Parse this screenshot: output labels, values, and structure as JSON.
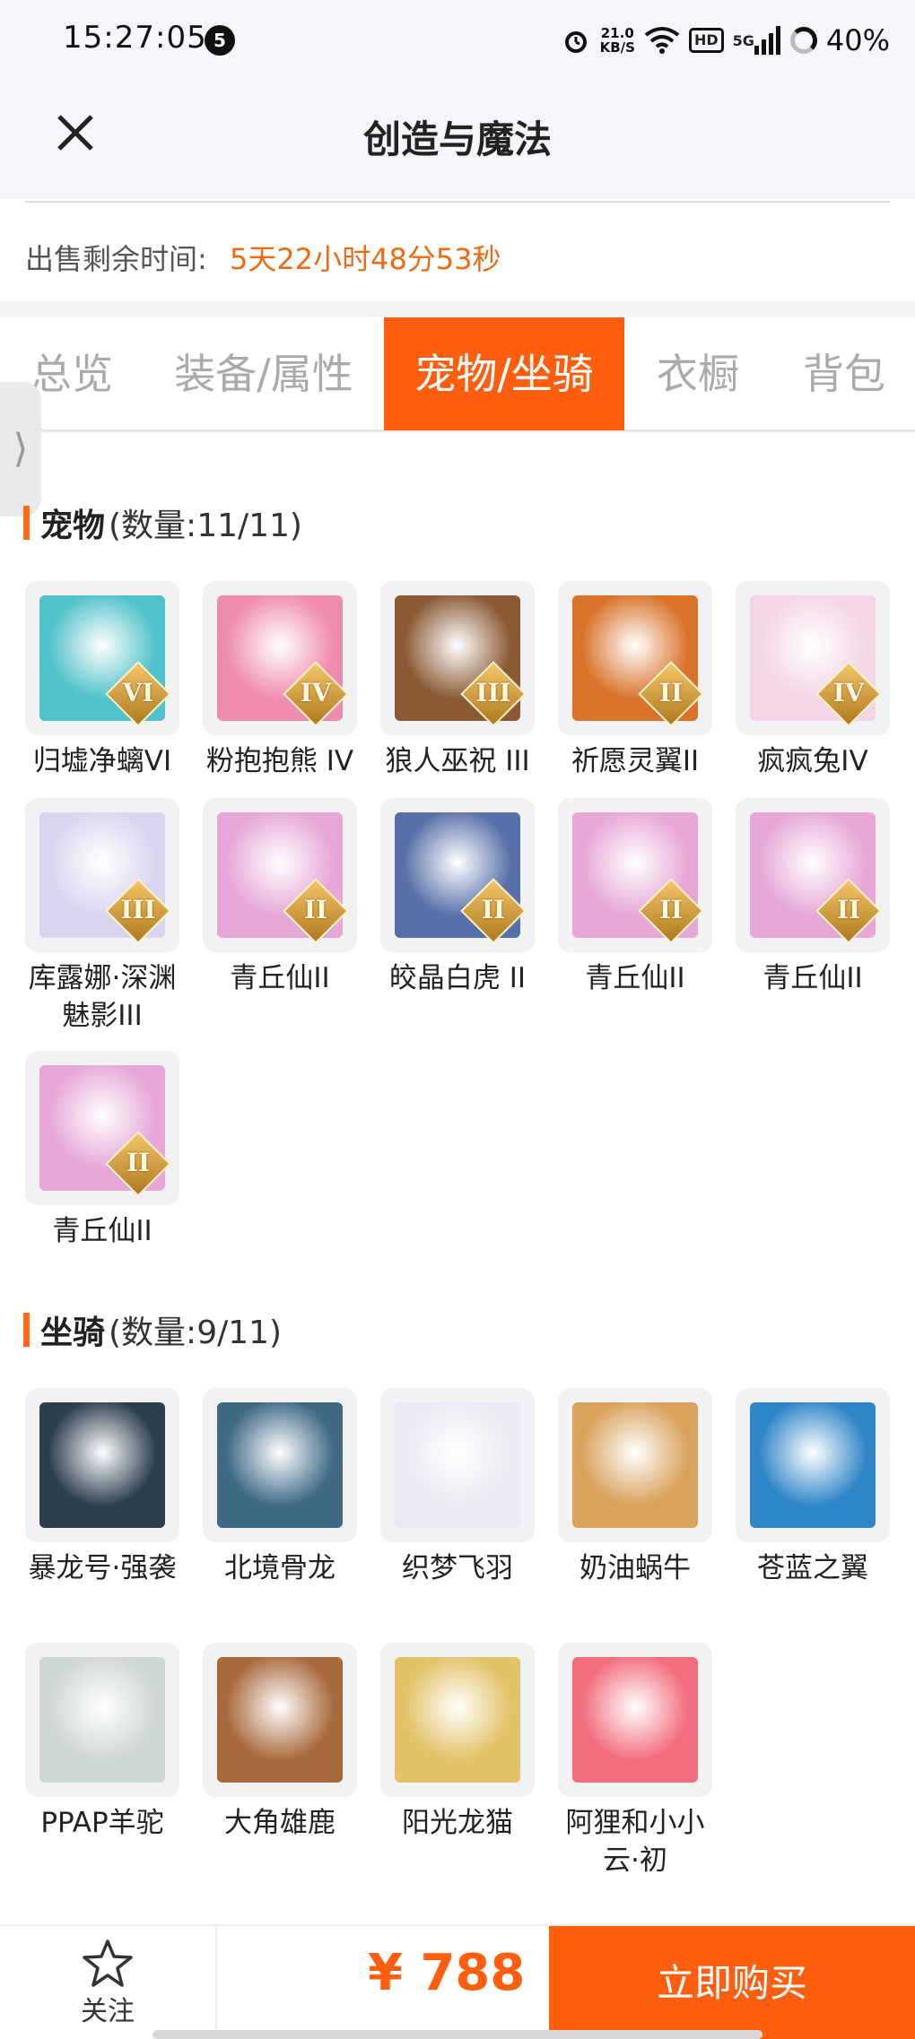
{
  "status_bar": {
    "time": "15:27:05",
    "notification_count": "5",
    "net_speed_value": "21.0",
    "net_speed_unit": "KB/S",
    "hd_label": "HD",
    "signal_label": "5G",
    "battery": "40%",
    "icons": [
      "alarm-icon",
      "wifi-icon",
      "hd-icon",
      "signal-icon",
      "battery-icon"
    ]
  },
  "header": {
    "title": "创造与魔法",
    "close_icon": "close-icon"
  },
  "sale": {
    "label": "出售剩余时间:",
    "value": "5天22小时48分53秒"
  },
  "tabs": [
    {
      "label": "总览",
      "active": false
    },
    {
      "label": "装备/属性",
      "active": false
    },
    {
      "label": "宠物/坐骑",
      "active": true
    },
    {
      "label": "衣橱",
      "active": false
    },
    {
      "label": "背包",
      "active": false
    }
  ],
  "side_handle": "⟩",
  "pets": {
    "title": "宠物",
    "count": "(数量:11/11)",
    "items": [
      {
        "name": "归墟净螭VI",
        "rank": "VI",
        "color": "#4fc3c9"
      },
      {
        "name": "粉抱抱熊 IV",
        "rank": "IV",
        "color": "#f08bb0"
      },
      {
        "name": "狼人巫祝 III",
        "rank": "III",
        "color": "#8a5a34"
      },
      {
        "name": "祈愿灵翼II",
        "rank": "II",
        "color": "#d9732a"
      },
      {
        "name": "疯疯兔IV",
        "rank": "IV",
        "color": "#f3d5e6"
      },
      {
        "name": "库露娜·深渊魅影III",
        "rank": "III",
        "color": "#d8d6ef"
      },
      {
        "name": "青丘仙II",
        "rank": "II",
        "color": "#e6a7d6"
      },
      {
        "name": "皎晶白虎 II",
        "rank": "II",
        "color": "#5870a8"
      },
      {
        "name": "青丘仙II",
        "rank": "II",
        "color": "#e6a7d6"
      },
      {
        "name": "青丘仙II",
        "rank": "II",
        "color": "#e6a7d6"
      },
      {
        "name": "青丘仙II",
        "rank": "II",
        "color": "#e6a7d6"
      }
    ]
  },
  "mounts": {
    "title": "坐骑",
    "count": "(数量:9/11)",
    "items": [
      {
        "name": "暴龙号·强袭",
        "color": "#2d3f4f"
      },
      {
        "name": "北境骨龙",
        "color": "#3f6a86"
      },
      {
        "name": "织梦飞羽",
        "color": "#e9eaf3"
      },
      {
        "name": "奶油蜗牛",
        "color": "#d8a25b"
      },
      {
        "name": "苍蓝之翼",
        "color": "#2f86c7"
      },
      {
        "name": "PPAP羊驼",
        "color": "#cfd6d6"
      },
      {
        "name": "大角雄鹿",
        "color": "#a86a3c"
      },
      {
        "name": "阳光龙猫",
        "color": "#e2c266"
      },
      {
        "name": "阿狸和小小云·初",
        "color": "#f26d7d"
      }
    ]
  },
  "bottom": {
    "follow_label": "关注",
    "price": "¥ 788",
    "buy_label": "立即购买"
  },
  "colors": {
    "accent": "#ff5e0e",
    "sale_value": "#f06a12",
    "header_bg": "#f4f6f9"
  }
}
